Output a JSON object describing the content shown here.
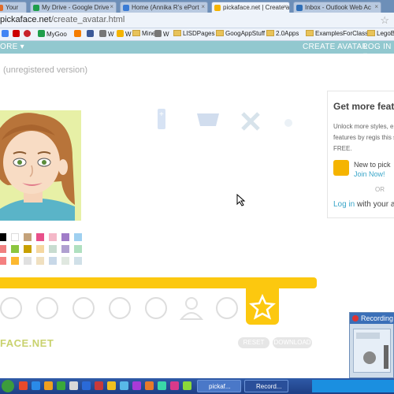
{
  "browser": {
    "tabs": [
      {
        "label": "Your",
        "active": false,
        "fav_color": "#e06c2a"
      },
      {
        "label": "My Drive - Google Drive",
        "active": false,
        "fav_color": "#1f9e4b"
      },
      {
        "label": "Home (Annika R's ePort",
        "active": false,
        "fav_color": "#3a7bd5"
      },
      {
        "label": "pickaface.net | Create a",
        "active": true,
        "fav_color": "#f5b400"
      },
      {
        "label": "Inbox - Outlook Web Ac",
        "active": false,
        "fav_color": "#2f6fb8"
      }
    ],
    "address": {
      "host": "pickaface.net",
      "path": "/create_avatar.html"
    },
    "bookmarks": [
      {
        "label": "",
        "icon": "g-icon",
        "color": "#4285f4",
        "folder": false
      },
      {
        "label": "",
        "icon": "youtube-icon",
        "color": "#cc0000",
        "folder": false
      },
      {
        "label": "",
        "icon": "pinterest-icon",
        "color": "#c8232c",
        "folder": false
      },
      {
        "label": "MyGoo",
        "icon": "drive-icon",
        "color": "#1f9e4b",
        "folder": false
      },
      {
        "label": "",
        "icon": "blogger-icon",
        "color": "#f57d00",
        "folder": false
      },
      {
        "label": "",
        "icon": "facebook-icon",
        "color": "#3b5998",
        "folder": false
      },
      {
        "label": "W",
        "icon": "site-icon",
        "color": "#777777",
        "folder": false
      },
      {
        "label": "W",
        "icon": "site-icon",
        "color": "#f5b400",
        "folder": false
      },
      {
        "label": "Mine",
        "icon": "folder-icon",
        "color": "#e8c35a",
        "folder": true
      },
      {
        "label": "W",
        "icon": "site-icon",
        "color": "#777777",
        "folder": false
      },
      {
        "label": "LISDPages",
        "icon": "folder-icon",
        "color": "#e8c35a",
        "folder": true
      },
      {
        "label": "GoogAppStuff",
        "icon": "folder-icon",
        "color": "#e8c35a",
        "folder": true
      },
      {
        "label": "2.0Apps",
        "icon": "folder-icon",
        "color": "#e8c35a",
        "folder": true
      },
      {
        "label": "ExamplesForClass",
        "icon": "folder-icon",
        "color": "#e8c35a",
        "folder": true
      },
      {
        "label": "LegoB",
        "icon": "folder-icon",
        "color": "#e8c35a",
        "folder": true
      }
    ]
  },
  "site_nav": {
    "left": "ORE ▾",
    "create": "CREATE AVATAR",
    "login": "LOG IN ▾"
  },
  "page": {
    "title": "(unregistered version)",
    "swatches": [
      "#000000",
      "#ffffff",
      "#c4a27a",
      "#e8508a",
      "#f4b8c8",
      "#a07cc8",
      "#9fd0f0",
      "#f08080",
      "#8cc63f",
      "#c8a000",
      "#f5d7a0",
      "#c8dcd0",
      "#b0a0d0",
      "#b0e0c0",
      "#f48080",
      "#fcb830",
      "#e0e0e0",
      "#f0e0c0",
      "#c8d8e8",
      "#e0e8e0",
      "#d0e0e8"
    ],
    "actions": {
      "reset": "RESET",
      "download": "DOWNLOAD"
    },
    "logo": "FACE.NET"
  },
  "panel": {
    "title": "Get more feature",
    "desc": "Unlock more styles, e and features by regis this site FREE.",
    "new_to": "New to pick",
    "join": "Join Now!",
    "or": "OR",
    "login_link": "Log in",
    "login_rest": " with your a"
  },
  "recording": {
    "title": "Recording"
  },
  "taskbar": {
    "buttons": [
      {
        "label": "pickaf...",
        "active": false
      },
      {
        "label": "Record...",
        "active": true
      }
    ]
  }
}
